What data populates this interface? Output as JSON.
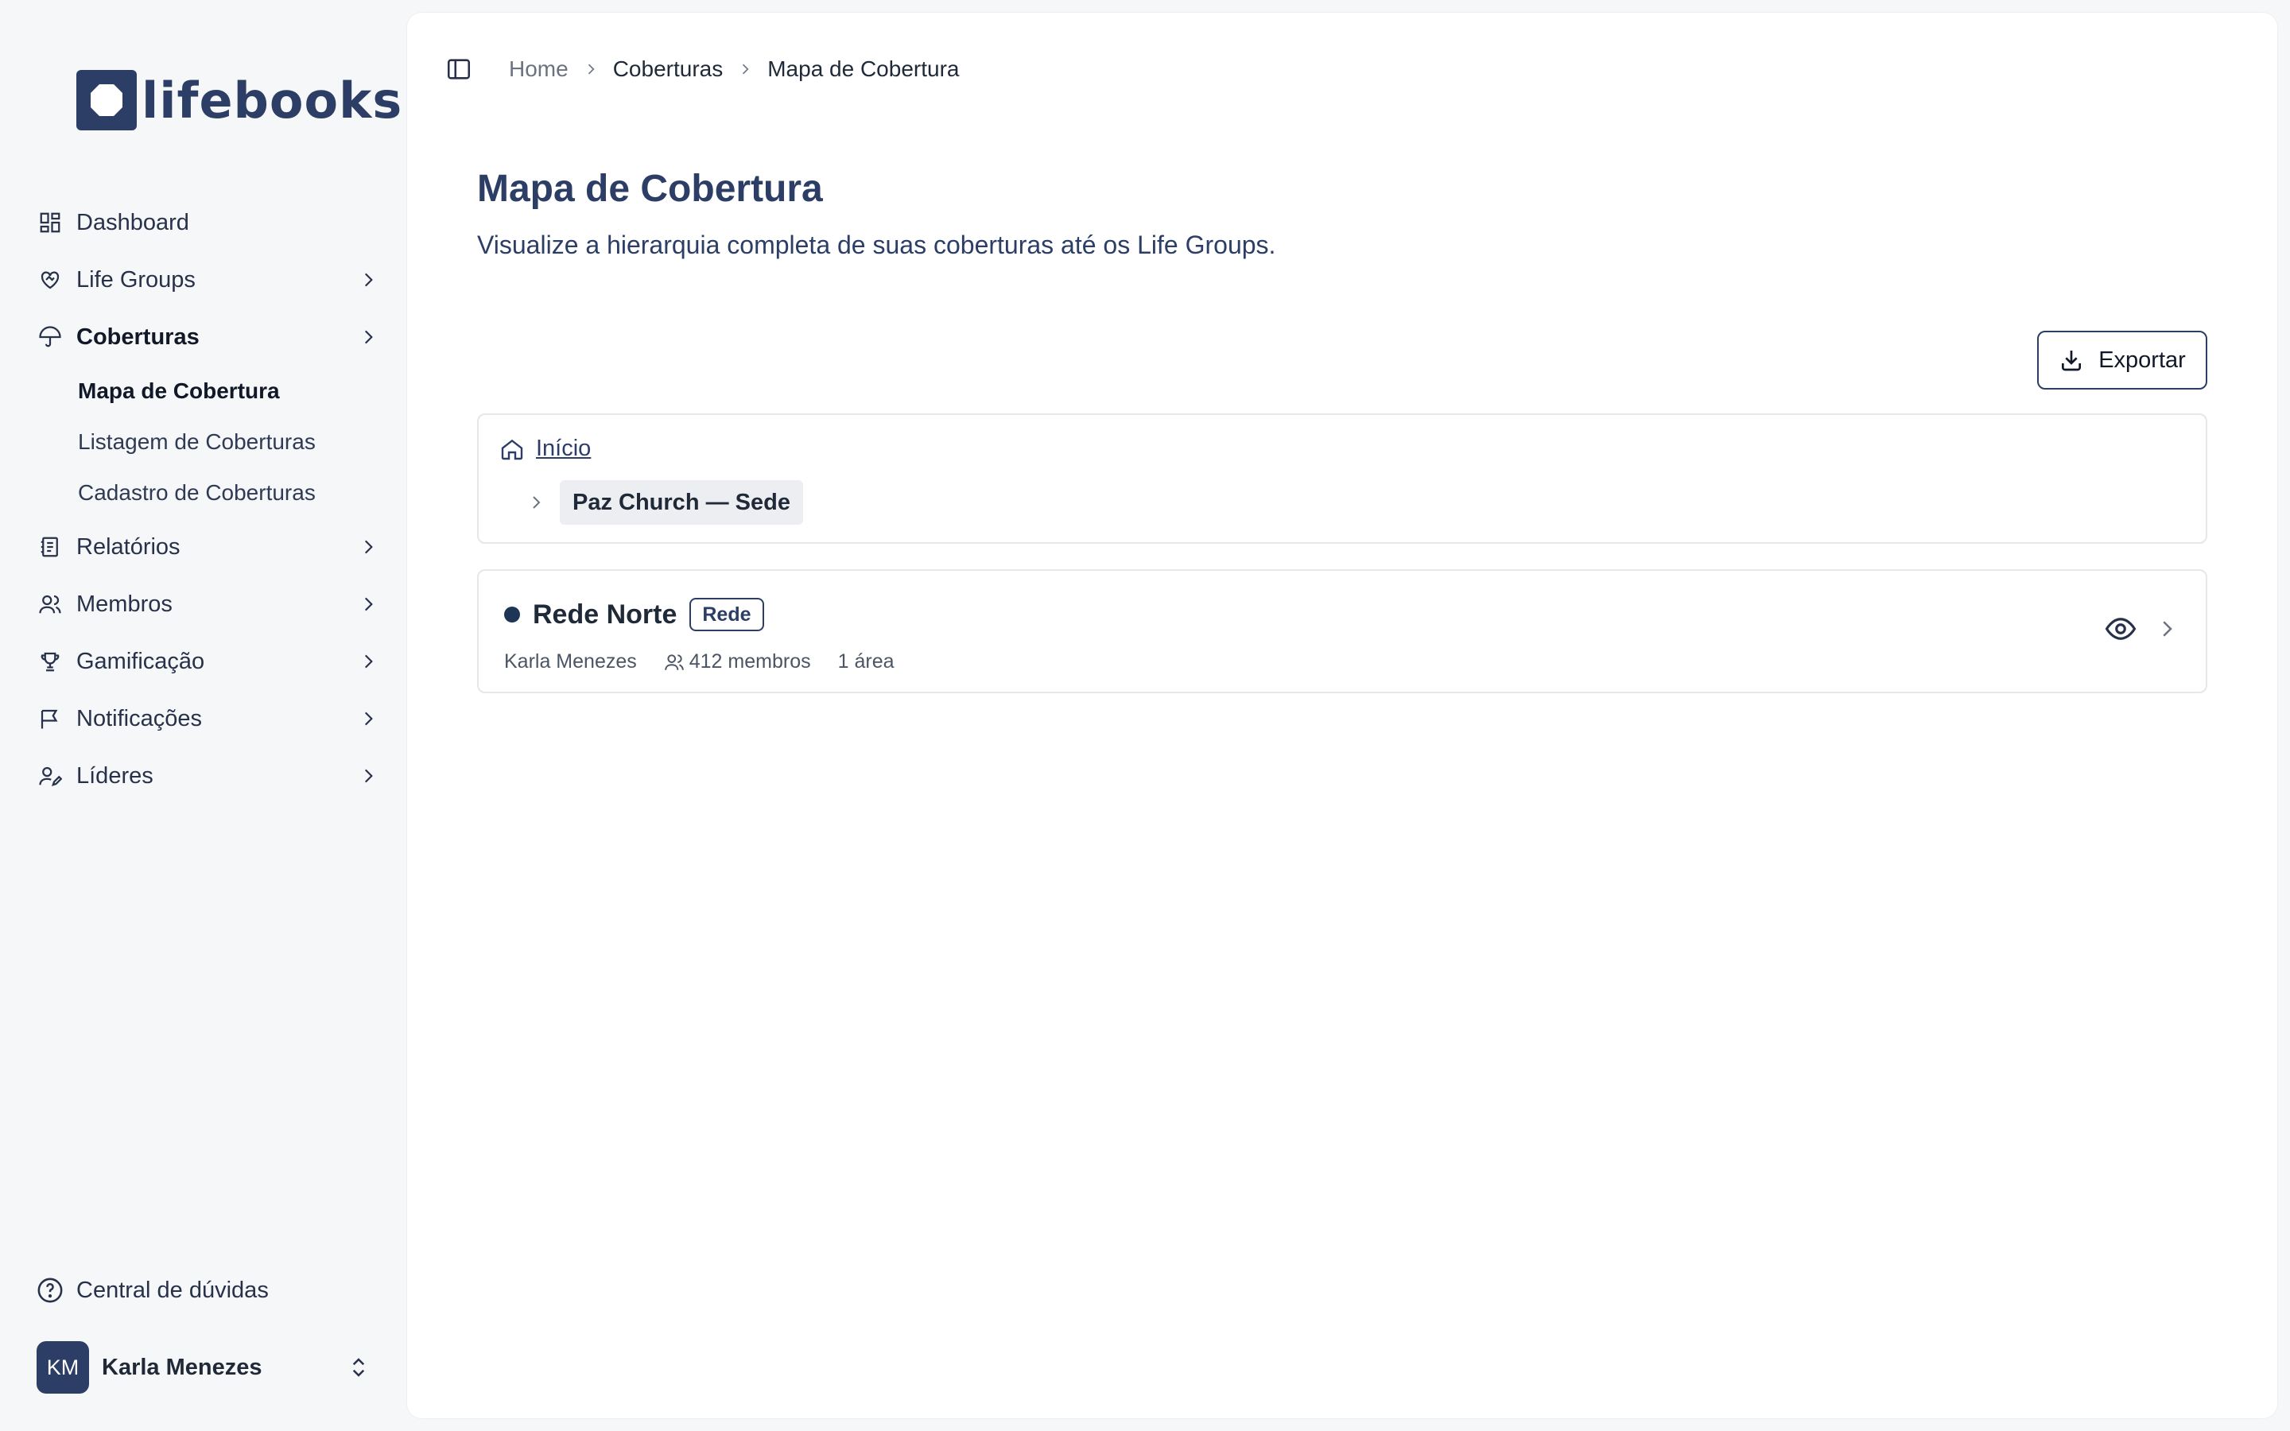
{
  "brand": {
    "name": "lifebooks",
    "color": "#2c3e66"
  },
  "sidebar": {
    "items": [
      {
        "label": "Dashboard",
        "icon": "dashboard-icon"
      },
      {
        "label": "Life Groups",
        "icon": "heart-handshake-icon"
      },
      {
        "label": "Coberturas",
        "icon": "umbrella-icon",
        "active": true
      },
      {
        "label": "Relatórios",
        "icon": "report-icon"
      },
      {
        "label": "Membros",
        "icon": "users-icon"
      },
      {
        "label": "Gamificação",
        "icon": "trophy-icon"
      },
      {
        "label": "Notificações",
        "icon": "flag-message-icon"
      },
      {
        "label": "Líderes",
        "icon": "user-pen-icon"
      }
    ],
    "subitems": [
      {
        "label": "Mapa de Cobertura",
        "active": true
      },
      {
        "label": "Listagem de Coberturas"
      },
      {
        "label": "Cadastro de Coberturas"
      }
    ],
    "help_label": "Central de dúvidas",
    "user": {
      "initials": "KM",
      "name": "Karla Menezes"
    }
  },
  "breadcrumb": {
    "home": "Home",
    "section": "Coberturas",
    "current": "Mapa de Cobertura"
  },
  "page": {
    "title": "Mapa de Cobertura",
    "subtitle": "Visualize a hierarquia completa de suas coberturas até os Life Groups."
  },
  "export_label": "Exportar",
  "tree": {
    "root_label": "Início",
    "node_label": "Paz Church — Sede"
  },
  "network": {
    "name": "Rede Norte",
    "badge": "Rede",
    "leader": "Karla Menezes",
    "members": "412 membros",
    "areas": "1 área"
  }
}
